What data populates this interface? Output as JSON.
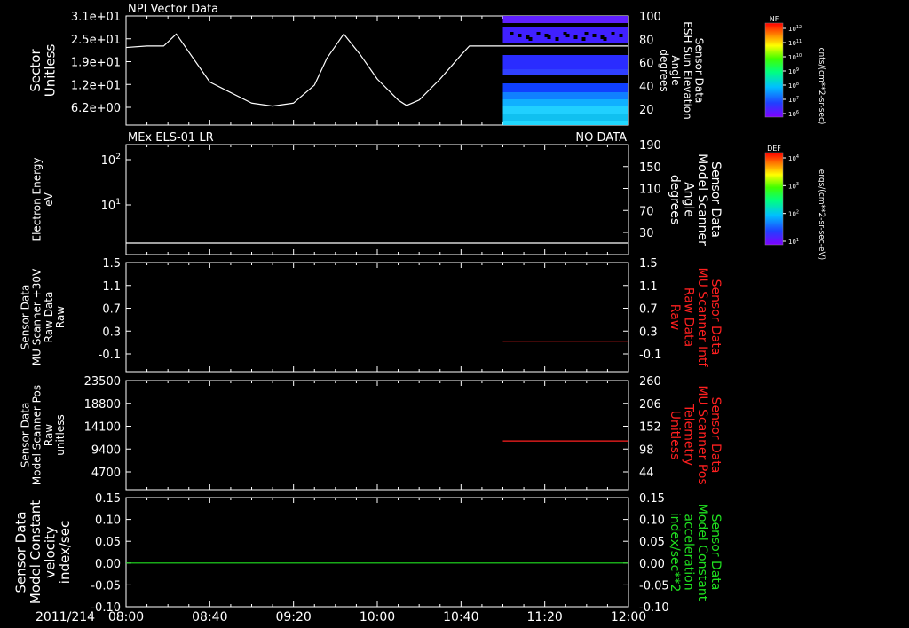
{
  "chart_data": [
    {
      "type": "line",
      "title": "NPI Vector Data",
      "ylabel": [
        "Sector",
        "Unitless"
      ],
      "yticks": [
        "3.1e+01",
        "2.5e+01",
        "1.9e+01",
        "1.2e+01",
        "6.2e+00"
      ],
      "ylim": [
        0,
        31
      ],
      "series": [
        {
          "x": [
            "08:00",
            "08:10",
            "08:14",
            "08:18",
            "08:24",
            "08:40",
            "09:00",
            "09:10",
            "09:20",
            "09:30",
            "09:36",
            "09:44",
            "09:52",
            "10:00",
            "10:10",
            "10:14",
            "10:20",
            "10:30",
            "10:40",
            "10:44",
            "11:00",
            "11:20",
            "11:40",
            "12:00"
          ],
          "y": [
            20.5,
            21,
            21,
            21,
            25,
            9,
            2,
            1,
            2,
            8,
            17,
            25,
            18,
            10,
            3,
            1.2,
            3,
            10,
            18,
            21,
            21,
            21,
            21,
            21
          ]
        }
      ],
      "right_axis": {
        "label": [
          "Sensor Data",
          "ESH Sun Elevation",
          "Angle",
          "degrees"
        ],
        "ticks": [
          "100",
          "80",
          "60",
          "40",
          "20"
        ],
        "ylim": [
          0,
          100
        ]
      },
      "spectrogram": {
        "x_start": "11:00",
        "x_end": "12:00"
      },
      "colorbar": {
        "title": "NF",
        "label": "cnts/(cm**2-sr-sec)",
        "ticks": [
          "10^12",
          "10^11",
          "10^10",
          "10^9",
          "10^8",
          "10^7",
          "10^6"
        ]
      }
    },
    {
      "type": "line",
      "title": "MEx ELS-01 LR",
      "status": "NO DATA",
      "ylabel": [
        "Electron Energy",
        "eV"
      ],
      "yticks": [
        "10^2",
        "10^1"
      ],
      "scale": "log",
      "series": [
        {
          "x": [
            "08:00",
            "12:00"
          ],
          "y": [
            2,
            2
          ]
        }
      ],
      "right_axis": {
        "label": [
          "Sensor Data",
          "Model Scanner",
          "Angle",
          "degrees"
        ],
        "ticks": [
          "190",
          "150",
          "110",
          "70",
          "30"
        ]
      },
      "colorbar": {
        "title": "DEF",
        "label": "ergs/(cm**2-sr-sec-eV)",
        "ticks": [
          "10^4",
          "10^3",
          "10^2",
          "10^1"
        ]
      }
    },
    {
      "type": "line",
      "ylabel": [
        "Sensor Data",
        "MU Scanner +30V",
        "Raw Data",
        "Raw"
      ],
      "yticks": [
        "1.5",
        "1.1",
        "0.7",
        "0.3",
        "-0.1"
      ],
      "ylim": [
        -0.3,
        1.5
      ],
      "series": [
        {
          "x": [
            "11:00",
            "12:00"
          ],
          "y": [
            -0.05,
            -0.05
          ],
          "color": "#ff2020"
        }
      ],
      "right_axis": {
        "label": [
          "Sensor Data",
          "MU Scanner Intf",
          "Raw Data",
          "Raw"
        ],
        "ticks": [
          "1.5",
          "1.1",
          "0.7",
          "0.3",
          "-0.1"
        ],
        "color": "#ff2020"
      }
    },
    {
      "type": "line",
      "ylabel": [
        "Sensor Data",
        "Model Scanner Pos",
        "Raw",
        "unitless"
      ],
      "yticks": [
        "23500",
        "18800",
        "14100",
        "9400",
        "4700"
      ],
      "ylim": [
        0,
        23500
      ],
      "series": [
        {
          "x": [
            "11:00",
            "12:00"
          ],
          "y": [
            7950,
            7950
          ],
          "color": "#ff2020"
        }
      ],
      "right_axis": {
        "label": [
          "Sensor Data",
          "MU Scanner Pos",
          "Telemetry",
          "Unitless"
        ],
        "ticks": [
          "260",
          "206",
          "152",
          "98",
          "44"
        ],
        "color": "#ff2020"
      }
    },
    {
      "type": "line",
      "ylabel": [
        "Sensor Data",
        "Model Constant",
        "velocity",
        "index/sec"
      ],
      "yticks": [
        "0.15",
        "0.10",
        "0.05",
        "0.00",
        "-0.05",
        "-0.10"
      ],
      "ylim": [
        -0.1,
        0.15
      ],
      "series": [
        {
          "x": [
            "08:00",
            "12:00"
          ],
          "y": [
            0,
            0
          ],
          "color": "#20e020"
        }
      ],
      "right_axis": {
        "label": [
          "Sensor Data",
          "Model Constant",
          "acceleration",
          "index/sec**2"
        ],
        "ticks": [
          "0.15",
          "0.10",
          "0.05",
          "0.00",
          "-0.05",
          "-0.10"
        ],
        "color": "#20e020"
      }
    }
  ],
  "x_axis": {
    "date": "2011/214",
    "ticks": [
      "08:00",
      "08:40",
      "09:20",
      "10:00",
      "10:40",
      "11:20",
      "12:00"
    ],
    "start": "08:00",
    "end": "12:00"
  }
}
